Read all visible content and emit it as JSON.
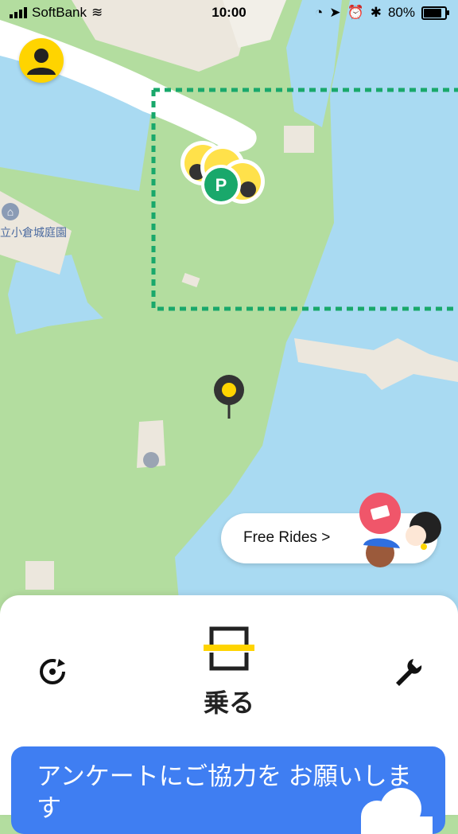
{
  "status_bar": {
    "carrier": "SoftBank",
    "time": "10:00",
    "battery": "80%",
    "battery_level": 0.8
  },
  "map": {
    "poi_label": "立小倉城庭園"
  },
  "free_rides": {
    "label": "Free Rides >"
  },
  "bottom_sheet": {
    "ride_label": "乗る",
    "survey_text": "アンケートにご協力を お願いします"
  },
  "colors": {
    "accent": "#ffd400",
    "water": "#a9daf2",
    "park": "#b3dd9f",
    "zone": "#19a86b",
    "survey": "#3f7ef2"
  }
}
